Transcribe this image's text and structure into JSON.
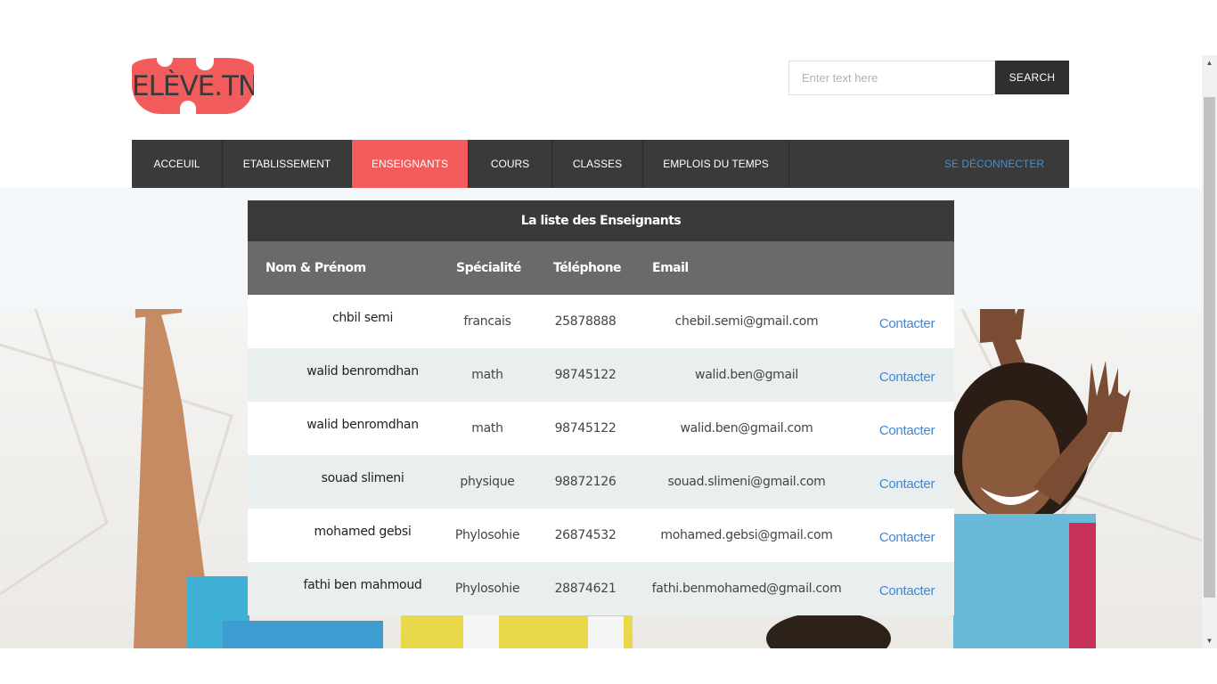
{
  "header": {
    "logo_text": "ELÈVE.TN",
    "search_placeholder": "Enter text here",
    "search_button": "SEARCH"
  },
  "nav": {
    "items": [
      {
        "label": "ACCEUIL"
      },
      {
        "label": "ETABLISSEMENT"
      },
      {
        "label": "ENSEIGNANTS",
        "active": true
      },
      {
        "label": "COURS"
      },
      {
        "label": "CLASSES"
      },
      {
        "label": "EMPLOIS DU TEMPS"
      }
    ],
    "logout": "SE DÉCONNECTER"
  },
  "table": {
    "title": "La liste des Enseignants",
    "headers": [
      "Nom & Prénom",
      "Spécialité",
      "Téléphone",
      "Email"
    ],
    "rows": [
      {
        "name": "chbil semi",
        "specialite": "francais",
        "telephone": "25878888",
        "email": "chebil.semi@gmail.com",
        "action": "Contacter"
      },
      {
        "name": "walid benromdhan",
        "specialite": "math",
        "telephone": "98745122",
        "email": "walid.ben@gmail",
        "action": "Contacter"
      },
      {
        "name": "walid benromdhan",
        "specialite": "math",
        "telephone": "98745122",
        "email": "walid.ben@gmail.com",
        "action": "Contacter"
      },
      {
        "name": "souad slimeni",
        "specialite": "physique",
        "telephone": "98872126",
        "email": "souad.slimeni@gmail.com",
        "action": "Contacter"
      },
      {
        "name": "mohamed gebsi",
        "specialite": "Phylosohie",
        "telephone": "26874532",
        "email": "mohamed.gebsi@gmail.com",
        "action": "Contacter"
      },
      {
        "name": "fathi ben mahmoud",
        "specialite": "Phylosohie",
        "telephone": "28874621",
        "email": "fathi.benmohamed@gmail.com",
        "action": "Contacter"
      }
    ]
  },
  "colors": {
    "accent": "#f25c5c",
    "nav_bg": "#3a3a3a",
    "link": "#3f86d4"
  }
}
